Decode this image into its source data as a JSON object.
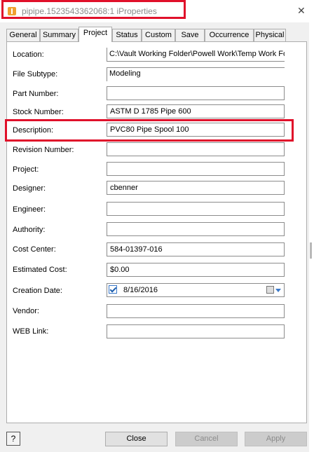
{
  "window": {
    "title": "pipipe.1523543362068:1 iProperties"
  },
  "tabs": [
    "General",
    "Summary",
    "Project",
    "Status",
    "Custom",
    "Save",
    "Occurrence",
    "Physical"
  ],
  "fields": {
    "location": {
      "label": "Location:",
      "value": "C:\\Vault Working Folder\\Powell Work\\Temp Work Fol"
    },
    "file_subtype": {
      "label": "File Subtype:",
      "value": "Modeling"
    },
    "part_number": {
      "label": "Part Number:",
      "value": ""
    },
    "stock_number": {
      "label": "Stock Number:",
      "value": "ASTM D 1785 Pipe 600"
    },
    "description": {
      "label": "Description:",
      "value": "PVC80 Pipe Spool 100"
    },
    "revision_number": {
      "label": "Revision Number:",
      "value": ""
    },
    "project": {
      "label": "Project:",
      "value": ""
    },
    "designer": {
      "label": "Designer:",
      "value": "cbenner"
    },
    "engineer": {
      "label": "Engineer:",
      "value": ""
    },
    "authority": {
      "label": "Authority:",
      "value": ""
    },
    "cost_center": {
      "label": "Cost Center:",
      "value": "584-01397-016"
    },
    "estimated_cost": {
      "label": "Estimated Cost:",
      "value": "$0.00"
    },
    "creation_date": {
      "label": "Creation Date:",
      "value": "8/16/2016",
      "checked": true
    },
    "vendor": {
      "label": "Vendor:",
      "value": ""
    },
    "web_link": {
      "label": "WEB Link:",
      "value": ""
    }
  },
  "buttons": {
    "help": "?",
    "close": "Close",
    "cancel": "Cancel",
    "apply": "Apply"
  },
  "colors": {
    "highlight": "#e0102a",
    "check": "#1e5fae",
    "disabled_text": "#8c8c8c"
  }
}
